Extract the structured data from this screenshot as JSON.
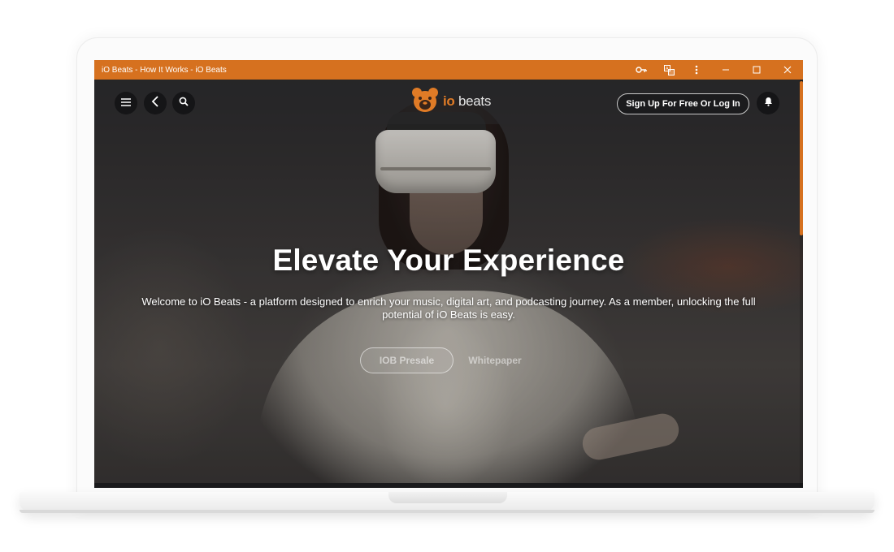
{
  "window": {
    "title": "iO Beats - How It Works - iO Beats",
    "accent_color": "#d6711f",
    "toolbar_icons": [
      "key-icon",
      "translate-icon",
      "more-vert-icon"
    ],
    "window_controls": [
      "minimize-icon",
      "maximize-icon",
      "close-icon"
    ]
  },
  "nav": {
    "left_icons": [
      "menu-icon",
      "back-icon",
      "search-icon"
    ],
    "logo_io": "io",
    "logo_beats": "beats",
    "signup_label": "Sign Up For Free Or Log In",
    "right_icon": "bell-icon"
  },
  "hero": {
    "title": "Elevate Your Experience",
    "description": "Welcome to iO Beats - a platform designed to enrich your music, digital art, and podcasting journey. As a member, unlocking the full potential of iO Beats is easy.",
    "primary_button": "IOB Presale",
    "secondary_button": "Whitepaper"
  }
}
